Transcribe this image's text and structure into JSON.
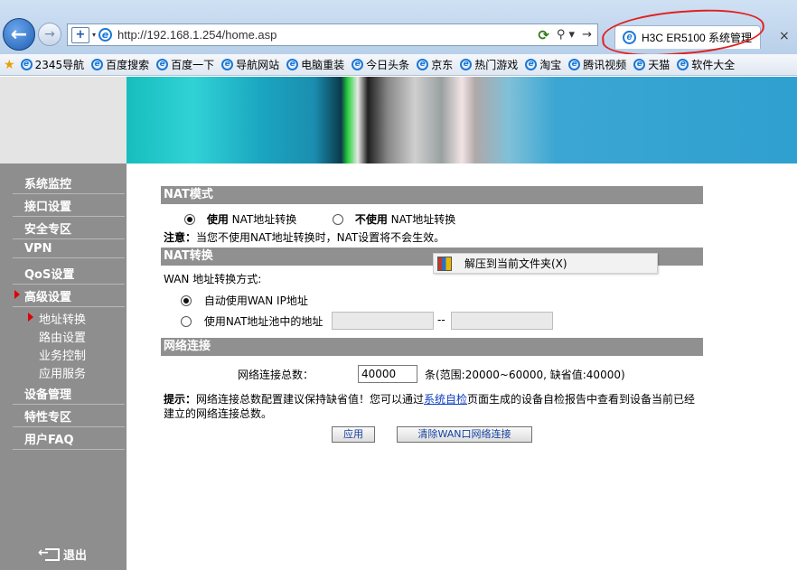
{
  "browser": {
    "url": "http://192.168.1.254/home.asp",
    "tab_title": "H3C ER5100 系统管理",
    "close_glyph": "×",
    "favorites": [
      "2345导航",
      "百度搜索",
      "百度一下",
      "导航网站",
      "电脑重装",
      "今日头条",
      "京东",
      "热门游戏",
      "淘宝",
      "腾讯视频",
      "天猫",
      "软件大全"
    ]
  },
  "sidebar": {
    "items": [
      "系统监控",
      "接口设置",
      "安全专区",
      "VPN",
      "QoS设置",
      "高级设置"
    ],
    "subitems": [
      "地址转换",
      "路由设置",
      "业务控制",
      "应用服务"
    ],
    "items_after": [
      "设备管理",
      "特性专区",
      "用户FAQ"
    ],
    "logout": "退出"
  },
  "nat_mode": {
    "header": "NAT模式",
    "opt1_bold": "使用",
    "opt1_rest": " NAT地址转换",
    "opt2_bold": "不使用",
    "opt2_rest": " NAT地址转换",
    "note_label": "注意：",
    "note_text": "当您不使用NAT地址转换时，NAT设置将不会生效。"
  },
  "nat_convert": {
    "header": "NAT转换",
    "wan_label": "WAN 地址转换方式:",
    "opt_auto": "自动使用WAN IP地址",
    "opt_pool": "使用NAT地址池中的地址",
    "dash": "--"
  },
  "net_conn": {
    "header": "网络连接",
    "total_label": "网络连接总数：",
    "total_value": "40000",
    "range_text": "条(范围:20000~60000, 缺省值:40000)",
    "tip_label": "提示：",
    "tip_text1": "网络连接总数配置建议保持缺省值！您可以通过",
    "tip_link": "系统自检",
    "tip_text2": "页面生成的设备自检报告中查看到设备当前已经",
    "tip_text3": "建立的网络连接总数。"
  },
  "buttons": {
    "apply": "应用",
    "clear": "清除WAN口网络连接"
  },
  "context_menu": {
    "item": "解压到当前文件夹(X)"
  }
}
